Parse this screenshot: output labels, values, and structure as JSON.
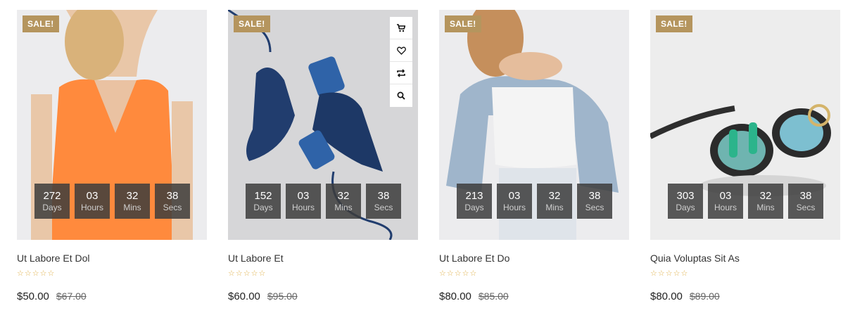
{
  "products": [
    {
      "badge": "SALE!",
      "title": "Ut Labore Et Dol",
      "price": "$50.00",
      "old_price": "$67.00",
      "rating_stars": "☆☆☆☆☆",
      "countdown": [
        {
          "value": "272",
          "label": "Days"
        },
        {
          "value": "03",
          "label": "Hours"
        },
        {
          "value": "32",
          "label": "Mins"
        },
        {
          "value": "38",
          "label": "Secs"
        }
      ]
    },
    {
      "badge": "SALE!",
      "title": "Ut Labore Et",
      "price": "$60.00",
      "old_price": "$95.00",
      "rating_stars": "☆☆☆☆☆",
      "countdown": [
        {
          "value": "152",
          "label": "Days"
        },
        {
          "value": "03",
          "label": "Hours"
        },
        {
          "value": "32",
          "label": "Mins"
        },
        {
          "value": "38",
          "label": "Secs"
        }
      ],
      "actions": [
        "cart-icon",
        "heart-icon",
        "compare-icon",
        "search-icon"
      ]
    },
    {
      "badge": "SALE!",
      "title": "Ut Labore Et Do",
      "price": "$80.00",
      "old_price": "$85.00",
      "rating_stars": "☆☆☆☆☆",
      "countdown": [
        {
          "value": "213",
          "label": "Days"
        },
        {
          "value": "03",
          "label": "Hours"
        },
        {
          "value": "32",
          "label": "Mins"
        },
        {
          "value": "38",
          "label": "Secs"
        }
      ]
    },
    {
      "badge": "SALE!",
      "title": "Quia Voluptas Sit As",
      "price": "$80.00",
      "old_price": "$89.00",
      "rating_stars": "☆☆☆☆☆",
      "countdown": [
        {
          "value": "303",
          "label": "Days"
        },
        {
          "value": "03",
          "label": "Hours"
        },
        {
          "value": "32",
          "label": "Mins"
        },
        {
          "value": "38",
          "label": "Secs"
        }
      ]
    }
  ],
  "colors": {
    "sale_badge": "#b5955e",
    "star": "#e0b04a",
    "countdown_bg": "#3c3c3c"
  }
}
